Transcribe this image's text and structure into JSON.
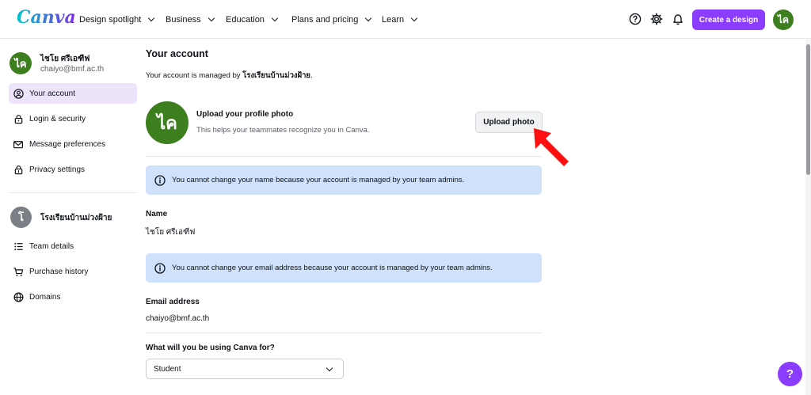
{
  "brand": {
    "logo": "Canva",
    "accent": "#8b3dff",
    "avatar_color": "#3d7f1e"
  },
  "nav": {
    "items": [
      {
        "label": "Design spotlight"
      },
      {
        "label": "Business"
      },
      {
        "label": "Education"
      },
      {
        "label": "Plans and pricing"
      },
      {
        "label": "Learn"
      }
    ],
    "icons": [
      "help-circle-icon",
      "gear-icon",
      "bell-icon"
    ],
    "create_label": "Create a design",
    "avatar_initials": "ไค"
  },
  "sidebar": {
    "user_initials": "ไค",
    "user_name": "ไชโย ศรีเอฑีฟ",
    "user_email": "chaiyo@bmf.ac.th",
    "account_items": [
      {
        "label": "Your account",
        "icon": "user-circle-icon",
        "active": true
      },
      {
        "label": "Login & security",
        "icon": "lock-icon"
      },
      {
        "label": "Message preferences",
        "icon": "mail-icon"
      },
      {
        "label": "Privacy settings",
        "icon": "shield-lock-icon"
      }
    ],
    "team_initial": "โ",
    "team_name": "โรงเรียนบ้านม่วงฝ้าย",
    "team_items": [
      {
        "label": "Team details",
        "icon": "list-icon"
      },
      {
        "label": "Purchase history",
        "icon": "cart-icon"
      },
      {
        "label": "Domains",
        "icon": "globe-icon"
      }
    ]
  },
  "main": {
    "title": "Your account",
    "managed_prefix": "Your account is managed by ",
    "managed_org": "โรงเรียนบ้านม่วงฝ้าย",
    "managed_suffix": ".",
    "photo": {
      "initials": "ไค",
      "title": "Upload your profile photo",
      "description": "This helps your teammates recognize you in Canva.",
      "button": "Upload photo"
    },
    "name_notice": "You cannot change your name because your account is managed by your team admins.",
    "name_label": "Name",
    "name_value": "ไชโย ศรีเอฑีฟ",
    "email_notice": "You cannot change your email address because your account is managed by your team admins.",
    "email_label": "Email address",
    "email_value": "chaiyo@bmf.ac.th",
    "usage_label": "What will you be using Canva for?",
    "usage_value": "Student"
  },
  "help_fab": "?"
}
